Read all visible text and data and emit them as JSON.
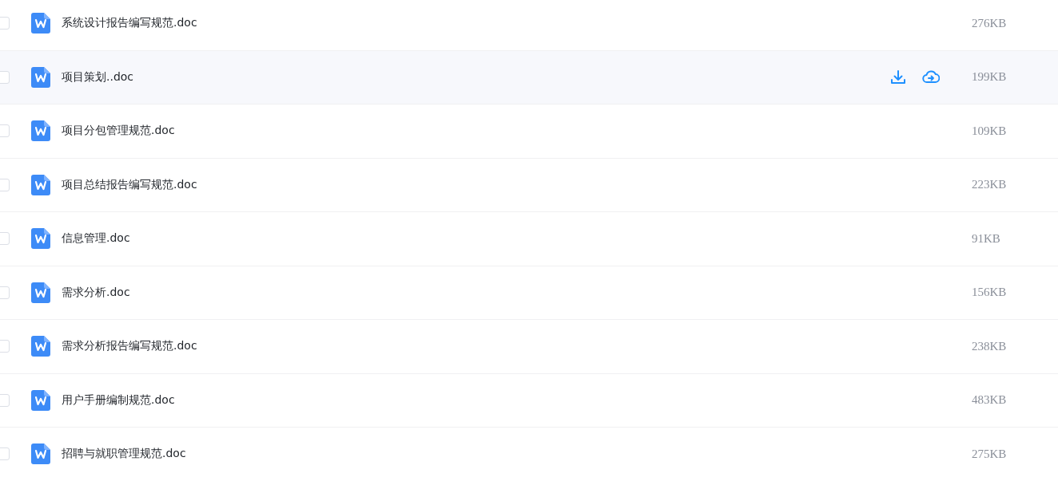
{
  "files": [
    {
      "name": "系统设计报告编写规范.doc",
      "size": "276KB",
      "checked": false,
      "hovered": false
    },
    {
      "name": "项目策划..doc",
      "size": "199KB",
      "checked": false,
      "hovered": true
    },
    {
      "name": "项目分包管理规范.doc",
      "size": "109KB",
      "checked": false,
      "hovered": false
    },
    {
      "name": "项目总结报告编写规范.doc",
      "size": "223KB",
      "checked": false,
      "hovered": false
    },
    {
      "name": "信息管理.doc",
      "size": "91KB",
      "checked": false,
      "hovered": false
    },
    {
      "name": "需求分析.doc",
      "size": "156KB",
      "checked": false,
      "hovered": false
    },
    {
      "name": "需求分析报告编写规范.doc",
      "size": "238KB",
      "checked": false,
      "hovered": false
    },
    {
      "name": "用户手册编制规范.doc",
      "size": "483KB",
      "checked": false,
      "hovered": false
    },
    {
      "name": "招聘与就职管理规范.doc",
      "size": "275KB",
      "checked": false,
      "hovered": false
    }
  ]
}
